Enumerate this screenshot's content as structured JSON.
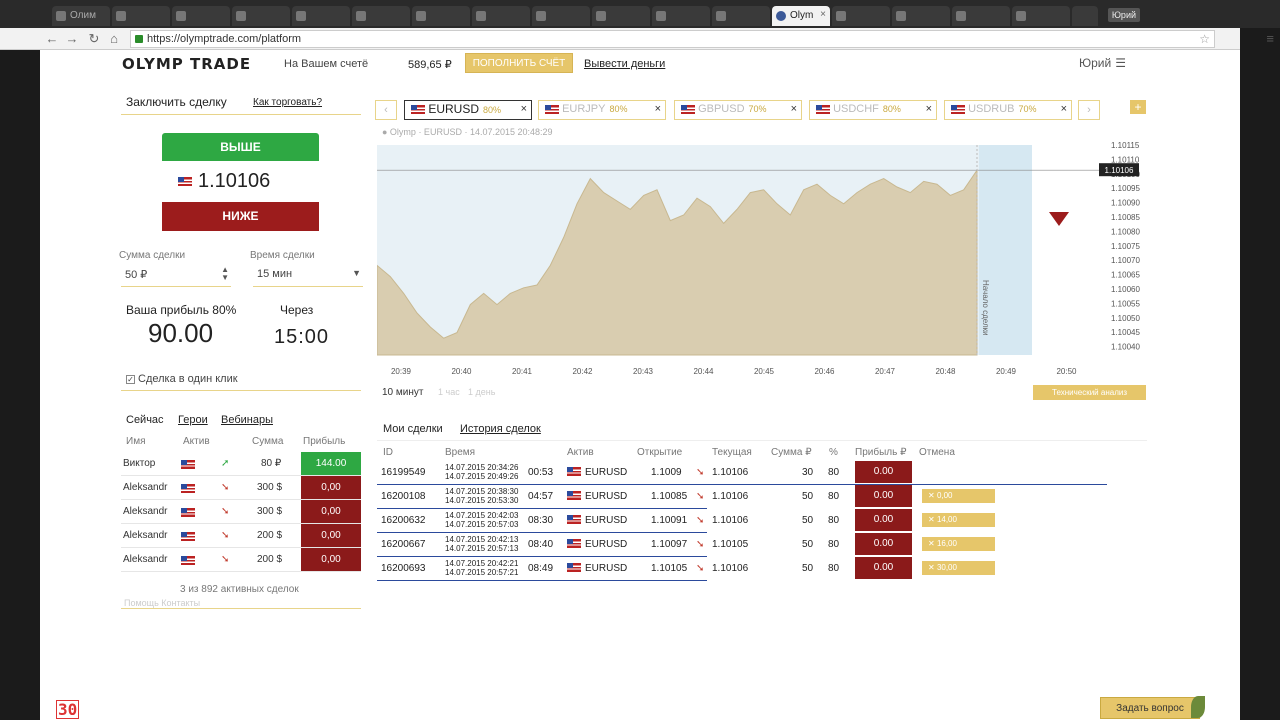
{
  "browser": {
    "tabs": [
      {
        "title": "Олим",
        "active": false
      },
      {
        "title": "Olym",
        "active": true
      }
    ],
    "user_chip": "Юрий",
    "url": "https://olymptrade.com/platform"
  },
  "header": {
    "logo": "OLYMP TRADE",
    "account_label": "На Вашем счетё",
    "balance": "589,65 ₽",
    "topup_label": "ПОПОЛНИТЬ СЧЁТ",
    "withdraw_label": "Вывести деньги",
    "username": "Юрий"
  },
  "deal": {
    "title": "Заключить сделку",
    "howto": "Как торговать?",
    "up_label": "ВЫШЕ",
    "down_label": "НИЖЕ",
    "price": "1.10106",
    "amount_label": "Сумма сделки",
    "amount_value": "50 ₽",
    "time_label": "Время сделки",
    "time_value": "15 мин",
    "profit_label": "Ваша прибыль 80%",
    "profit_value": "90.00",
    "via_label": "Через",
    "via_value": "15:00",
    "oneclick_label": "Сделка в один клик",
    "oneclick_checked": true
  },
  "live": {
    "tabs": [
      "Сейчас",
      "Герои",
      "Вебинары"
    ],
    "headers": [
      "Имя",
      "Актив",
      "Сумма",
      "Прибыль"
    ],
    "rows": [
      {
        "name": "Виктор",
        "dir": "up",
        "amount": "80 ₽",
        "profit": "144.00",
        "win": true
      },
      {
        "name": "Aleksandr",
        "dir": "down",
        "amount": "300 $",
        "profit": "0,00",
        "win": false
      },
      {
        "name": "Aleksandr",
        "dir": "down",
        "amount": "300 $",
        "profit": "0,00",
        "win": false
      },
      {
        "name": "Aleksandr",
        "dir": "down",
        "amount": "200 $",
        "profit": "0,00",
        "win": false
      },
      {
        "name": "Aleksandr",
        "dir": "down",
        "amount": "200 $",
        "profit": "0,00",
        "win": false
      }
    ],
    "footer": "3 из 892 активных сделок",
    "footer2": "Помощь   Контакты"
  },
  "assets": {
    "tabs": [
      {
        "name": "EURUSD",
        "pct": "80%",
        "active": true
      },
      {
        "name": "EURJPY",
        "pct": "80%",
        "active": false
      },
      {
        "name": "GBPUSD",
        "pct": "70%",
        "active": false
      },
      {
        "name": "USDCHF",
        "pct": "80%",
        "active": false
      },
      {
        "name": "USDRUB",
        "pct": "70%",
        "active": false
      }
    ],
    "caption": "● Olymp · EURUSD · 14.07.2015 20:48:29"
  },
  "chart_data": {
    "type": "area",
    "x_ticks": [
      "20:39",
      "20:40",
      "20:41",
      "20:42",
      "20:43",
      "20:44",
      "20:45",
      "20:46",
      "20:47",
      "20:48",
      "20:49",
      "20:50"
    ],
    "y_ticks": [
      "1.10115",
      "1.10110",
      "1.10100",
      "1.10095",
      "1.10090",
      "1.10085",
      "1.10080",
      "1.10075",
      "1.10070",
      "1.10065",
      "1.10060",
      "1.10055",
      "1.10050",
      "1.10045",
      "1.10040"
    ],
    "ylim": [
      1.1004,
      1.10115
    ],
    "current_price": "1.10106",
    "deal_start_label": "Начало сделки",
    "values": [
      1.10072,
      1.10068,
      1.10062,
      1.10055,
      1.1005,
      1.10046,
      1.10048,
      1.10058,
      1.10062,
      1.10058,
      1.10062,
      1.10064,
      1.10065,
      1.10072,
      1.10082,
      1.10094,
      1.10103,
      1.10098,
      1.10095,
      1.10092,
      1.10097,
      1.10099,
      1.10088,
      1.1009,
      1.10096,
      1.10093,
      1.10087,
      1.10092,
      1.10098,
      1.10099,
      1.10094,
      1.1009,
      1.10099,
      1.10101,
      1.10097,
      1.10094,
      1.10098,
      1.10101,
      1.10103,
      1.101,
      1.10098,
      1.10102,
      1.10101,
      1.10097,
      1.10099,
      1.10106
    ]
  },
  "timeframe": {
    "active": "10 минут",
    "others": [
      "1 час",
      "1 день"
    ],
    "tech_label": "Технический анализ"
  },
  "deals": {
    "tabs": [
      "Мои сделки",
      "История сделок"
    ],
    "headers": [
      "ID",
      "Время",
      "Актив",
      "Открытие",
      "Текущая",
      "Сумма ₽",
      "%",
      "Прибыль ₽",
      "Отмена"
    ],
    "rows": [
      {
        "id": "16199549",
        "t1": "14.07.2015 20:34:26",
        "t2": "14.07.2015 20:49:26",
        "left": "00:53",
        "asset": "EURUSD",
        "open": "1.1009",
        "dir": "down",
        "cur": "1.10106",
        "sum": "30",
        "pct": "80",
        "profit": "0.00",
        "cancel": ""
      },
      {
        "id": "16200108",
        "t1": "14.07.2015 20:38:30",
        "t2": "14.07.2015 20:53:30",
        "left": "04:57",
        "asset": "EURUSD",
        "open": "1.10085",
        "dir": "down",
        "cur": "1.10106",
        "sum": "50",
        "pct": "80",
        "profit": "0.00",
        "cancel": "0,00"
      },
      {
        "id": "16200632",
        "t1": "14.07.2015 20:42:03",
        "t2": "14.07.2015 20:57:03",
        "left": "08:30",
        "asset": "EURUSD",
        "open": "1.10091",
        "dir": "down",
        "cur": "1.10106",
        "sum": "50",
        "pct": "80",
        "profit": "0.00",
        "cancel": "14,00"
      },
      {
        "id": "16200667",
        "t1": "14.07.2015 20:42:13",
        "t2": "14.07.2015 20:57:13",
        "left": "08:40",
        "asset": "EURUSD",
        "open": "1.10097",
        "dir": "down",
        "cur": "1.10105",
        "sum": "50",
        "pct": "80",
        "profit": "0.00",
        "cancel": "16,00"
      },
      {
        "id": "16200693",
        "t1": "14.07.2015 20:42:21",
        "t2": "14.07.2015 20:57:21",
        "left": "08:49",
        "asset": "EURUSD",
        "open": "1.10105",
        "dir": "down",
        "cur": "1.10106",
        "sum": "50",
        "pct": "80",
        "profit": "0.00",
        "cancel": "30,00"
      }
    ]
  },
  "ask_button": "Задать вопрос",
  "overlay_number": "30",
  "colors": {
    "up": "#2ea843",
    "down": "#9c1c1c",
    "gold": "#e6c66a",
    "area": "#d9cdb0",
    "chart_bg": "#e6f0f5"
  }
}
